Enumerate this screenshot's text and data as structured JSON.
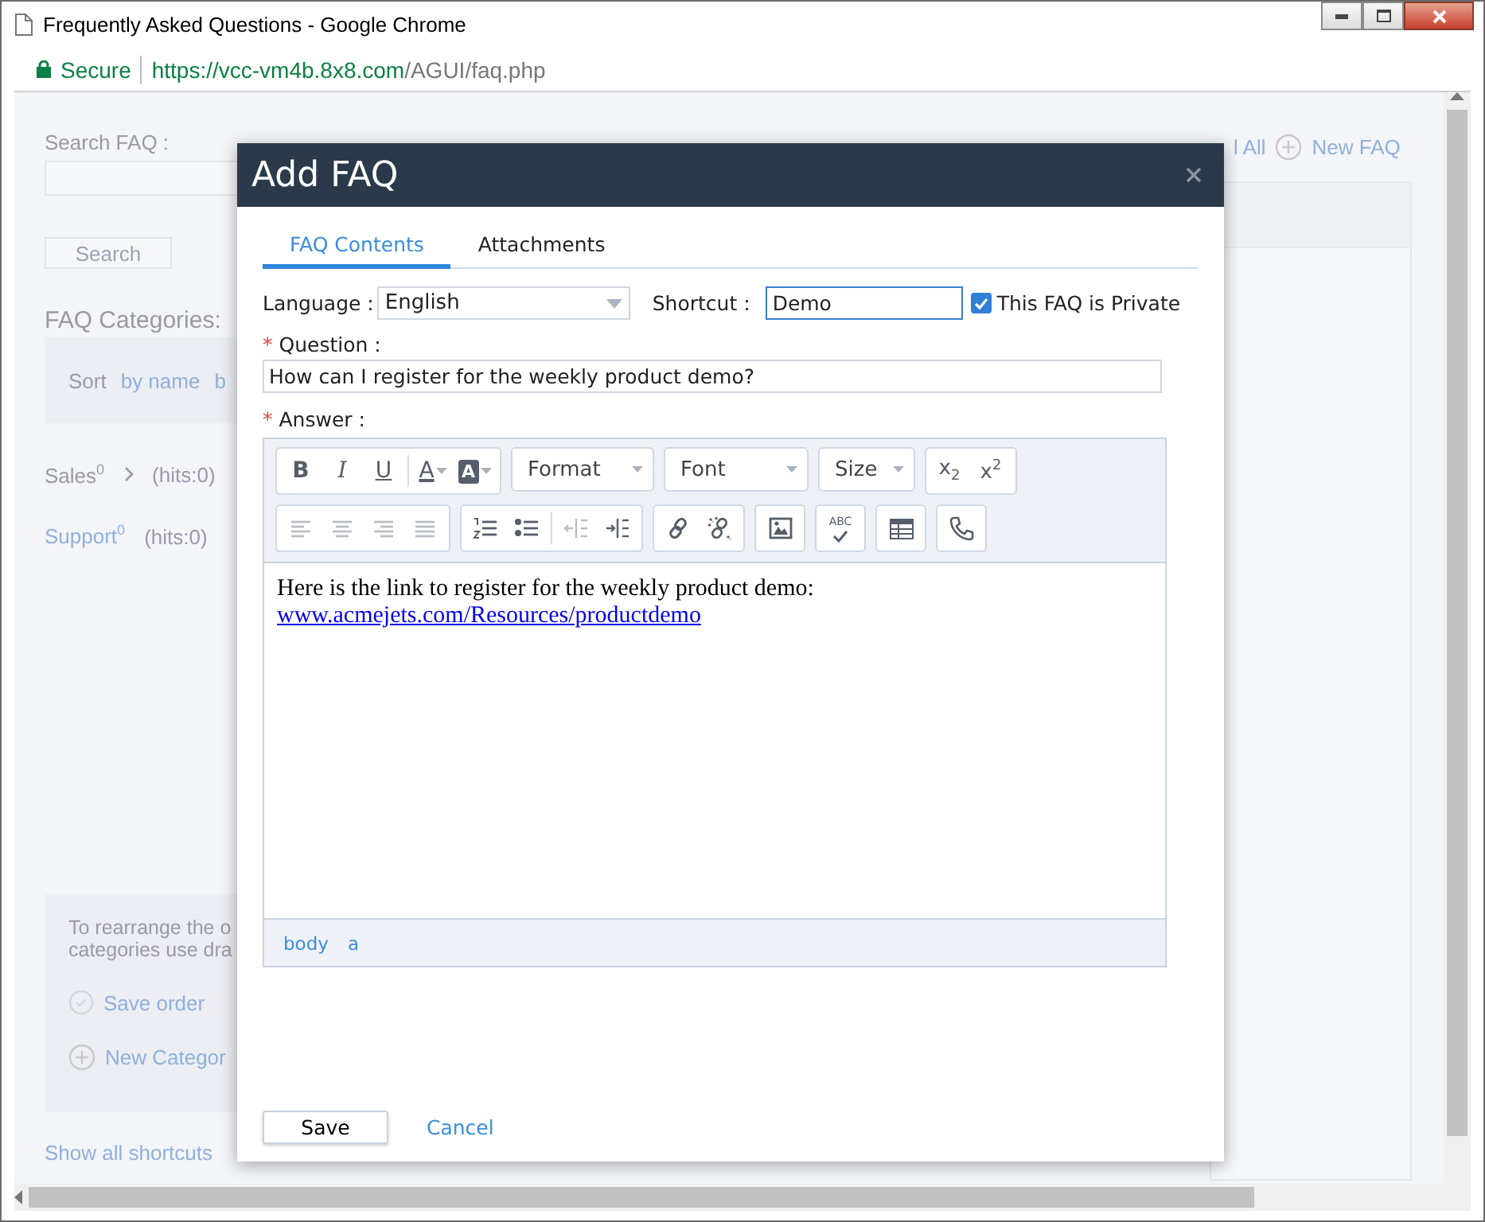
{
  "window": {
    "title": "Frequently Asked Questions - Google Chrome"
  },
  "address_bar": {
    "security": "Secure",
    "url_host": "https://vcc-vm4b.8x8.com",
    "url_path": "/AGUI/faq.php"
  },
  "page": {
    "search_label": "Search FAQ :",
    "search_button": "Search",
    "categories_title": "FAQ Categories:",
    "sort_label": "Sort",
    "sort_options": [
      "by name",
      "b"
    ],
    "categories": [
      {
        "name": "Sales",
        "count": "0",
        "expandable": true,
        "hits": "(hits:0)"
      },
      {
        "name": "Support",
        "count": "0",
        "expandable": false,
        "hits": "(hits:0)"
      }
    ],
    "help_lines": [
      "To rearrange the o",
      "categories use dra"
    ],
    "save_order": "Save order",
    "new_category": "New Categor",
    "show_shortcuts": "Show all shortcuts",
    "expand_all": "l All",
    "new_faq": "New FAQ"
  },
  "dialog": {
    "title": "Add FAQ",
    "tabs": [
      {
        "label": "FAQ Contents",
        "selected": true
      },
      {
        "label": "Attachments",
        "selected": false
      }
    ],
    "language": {
      "label": "Language :",
      "value": "English"
    },
    "shortcut": {
      "label": "Shortcut :",
      "value": "Demo",
      "focused": true
    },
    "private": {
      "label": "This FAQ is Private",
      "checked": true
    },
    "question": {
      "required_mark": "*",
      "label": "Question :",
      "value": "How can I register for the weekly product demo?"
    },
    "answer": {
      "required_mark": "*",
      "label": "Answer :",
      "toolbar": {
        "bold": "B",
        "italic": "I",
        "underline": "U",
        "text_color": "A",
        "background_color": "A",
        "format": "Format",
        "font": "Font",
        "size": "Size",
        "subscript": "x$_{2}$",
        "superscript": "x$^{2}$",
        "alignment": {
          "disabled": true
        },
        "outdent": {
          "disabled": true
        },
        "spellcheck": "ABC"
      },
      "text": "Here is the link to register for the weekly product demo:",
      "link": "www.acmejets.com/Resources/productdemo",
      "path": [
        "body",
        "a"
      ]
    },
    "buttons": {
      "save": "Save",
      "cancel": "Cancel"
    }
  }
}
